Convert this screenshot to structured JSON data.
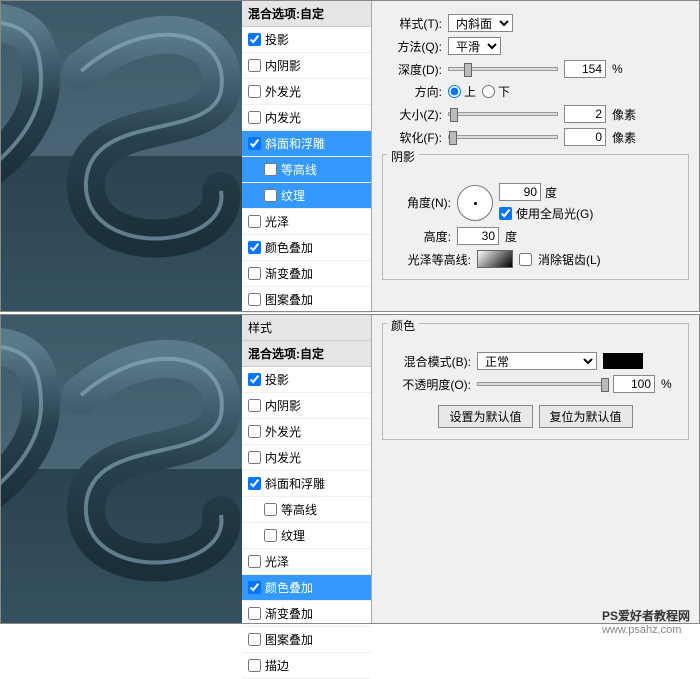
{
  "common": {
    "stylesHeader": "样式",
    "blendTitle": "混合选项:自定",
    "effects": {
      "dropShadow": "投影",
      "innerShadow": "内阴影",
      "outerGlow": "外发光",
      "innerGlow": "内发光",
      "bevel": "斜面和浮雕",
      "contour": "等高线",
      "texture": "纹理",
      "satin": "光泽",
      "colorOverlay": "颜色叠加",
      "gradientOverlay": "渐变叠加",
      "patternOverlay": "图案叠加",
      "stroke": "描边"
    }
  },
  "bevel": {
    "styleLabel": "样式(T):",
    "styleValue": "内斜面",
    "techLabel": "方法(Q):",
    "techValue": "平滑",
    "depthLabel": "深度(D):",
    "depthValue": "154",
    "percent": "%",
    "dirLabel": "方向:",
    "dirUp": "上",
    "dirDown": "下",
    "sizeLabel": "大小(Z):",
    "sizeValue": "2",
    "px": "像素",
    "softenLabel": "软化(F):",
    "softenValue": "0",
    "shadingTitle": "阴影",
    "angleLabel": "角度(N):",
    "angleValue": "90",
    "deg": "度",
    "globalLight": "使用全局光(G)",
    "altLabel": "高度:",
    "altValue": "30",
    "glossLabel": "光泽等高线:",
    "antiAlias": "消除锯齿(L)"
  },
  "color": {
    "sectionTitle": "颜色",
    "blendModeLabel": "混合模式(B):",
    "blendModeValue": "正常",
    "opacityLabel": "不透明度(O):",
    "opacityValue": "100",
    "percent": "%",
    "setDefault": "设置为默认值",
    "resetDefault": "复位为默认值"
  },
  "footer": {
    "main": "PS爱好者教程网",
    "sub": "www.psahz.com"
  }
}
